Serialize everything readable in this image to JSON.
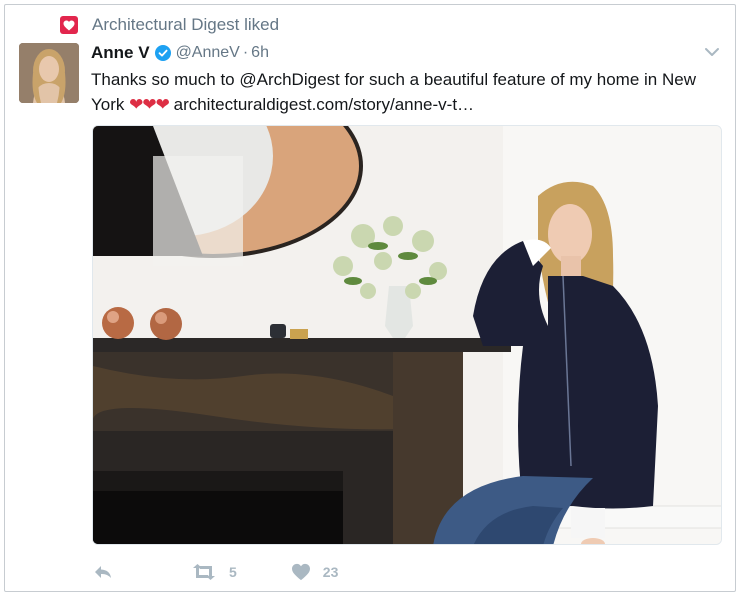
{
  "context": {
    "icon": "heart-icon",
    "text": "Architectural Digest liked",
    "accent": "#e2264d"
  },
  "tweet": {
    "name": "Anne V",
    "handle": "@AnneV",
    "separator": "·",
    "time": "6h",
    "text_main": "Thanks so much to @ArchDigest for such a beautiful feature of my home in New York",
    "hearts": "❤❤❤",
    "link": "architecturaldigest.com/story/anne-v-t…"
  },
  "actions": {
    "retweet_count": "5",
    "like_count": "23"
  },
  "colors": {
    "verified": "#1da1f2",
    "muted": "#657786",
    "icon_muted": "#aab8c2"
  }
}
